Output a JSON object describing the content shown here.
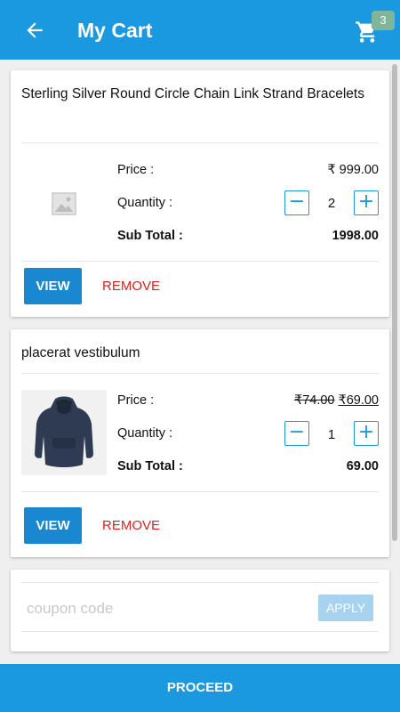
{
  "header": {
    "title": "My Cart",
    "cart_count": "3",
    "back_icon": "arrow-back-icon",
    "cart_icon": "shopping-cart-icon"
  },
  "labels": {
    "price": "Price :",
    "quantity": "Quantity :",
    "subtotal": "Sub Total :",
    "view": "VIEW",
    "remove": "REMOVE",
    "minus": "−",
    "plus": "+"
  },
  "items": [
    {
      "name": "Sterling Silver Round Circle Chain Link Strand Bracelets",
      "image": "image-placeholder-icon",
      "price": "₹ 999.00",
      "quantity": "2",
      "subtotal": "1998.00"
    },
    {
      "name": "placerat vestibulum",
      "image": "hoodie-photo",
      "original_price": "₹74.00",
      "price": "₹69.00",
      "quantity": "1",
      "subtotal": "69.00"
    }
  ],
  "coupon": {
    "placeholder": "coupon code",
    "apply_label": "APPLY"
  },
  "footer": {
    "proceed_label": "PROCEED"
  },
  "colors": {
    "primary": "#1a98e0",
    "remove": "#e0201c",
    "badge": "#7fb69a",
    "apply_disabled": "#a8d3f0"
  }
}
